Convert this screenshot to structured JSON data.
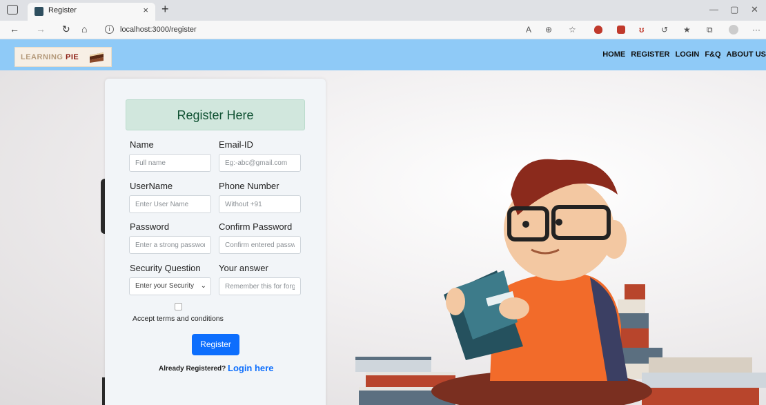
{
  "browser": {
    "tab_title": "Register",
    "tab_close": "×",
    "new_tab": "+",
    "url": "localhost:3000/register",
    "window_controls": [
      "—",
      "▢",
      "✕"
    ]
  },
  "site": {
    "logo": {
      "text_part1": "LEARNING",
      "text_part2": "PIE"
    },
    "nav": [
      "HOME",
      "REGISTER",
      "LOGIN",
      "F&Q",
      "ABOUT US"
    ]
  },
  "form": {
    "title": "Register Here",
    "name_label": "Name",
    "name_placeholder": "Full name",
    "email_label": "Email-ID",
    "email_placeholder": "Eg:-abc@gmail.com",
    "username_label": "UserName",
    "username_placeholder": "Enter User Name",
    "phone_label": "Phone Number",
    "phone_placeholder": "Without +91",
    "password_label": "Password",
    "password_placeholder": "Enter a strong password",
    "confirm_label": "Confirm Password",
    "confirm_placeholder": "Confirm entered password",
    "security_label": "Security Question",
    "security_selected": "Enter your Security",
    "answer_label": "Your answer",
    "answer_placeholder": "Remember this for forgot password",
    "terms_label": "Accept terms and conditions",
    "register_button": "Register",
    "already_text": "Already Registered?",
    "login_link": "Login here"
  },
  "colors": {
    "header_bg": "#8fcaf7",
    "title_bg": "#d1e7dd",
    "primary": "#0d6efd"
  }
}
